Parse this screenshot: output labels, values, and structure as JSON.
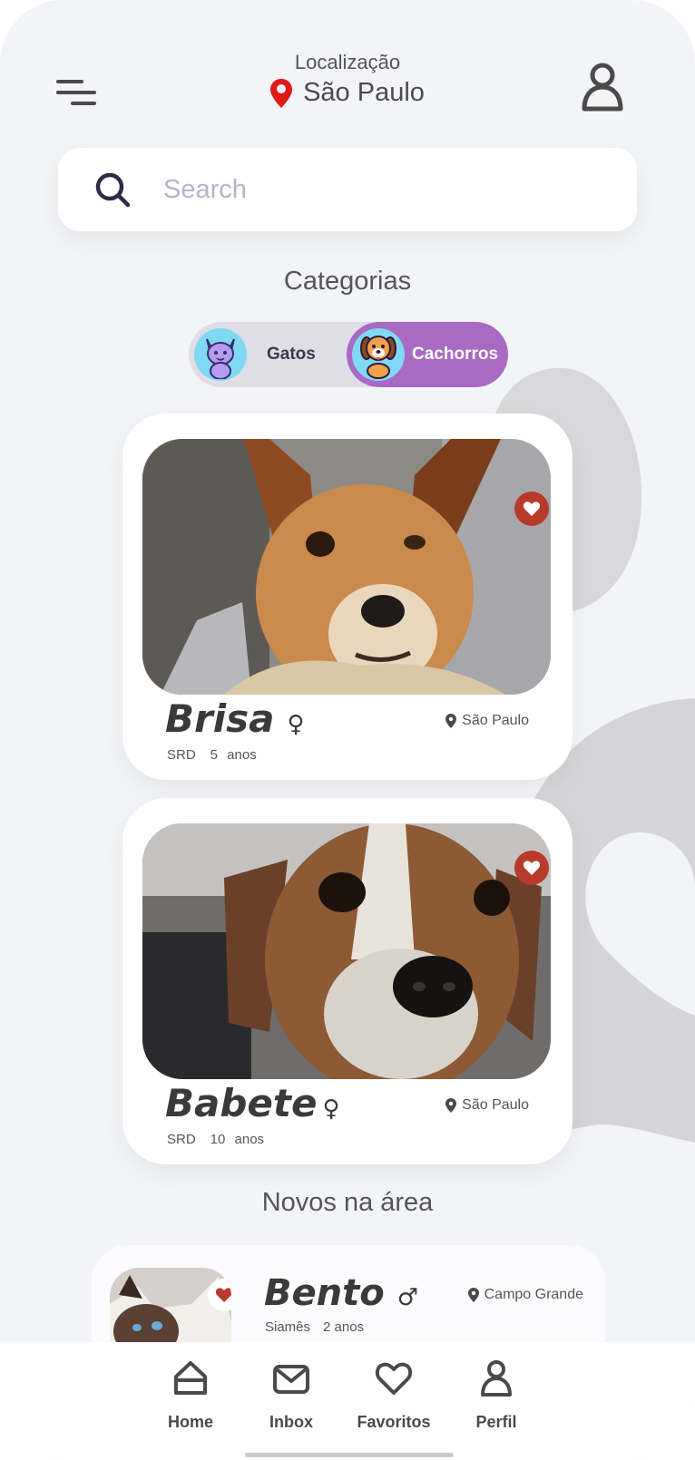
{
  "header": {
    "location_label": "Localização",
    "location_city": "São Paulo",
    "location_pin_color": "#e01818"
  },
  "search": {
    "placeholder": "Search"
  },
  "categories": {
    "title": "Categorias",
    "items": [
      {
        "label": "Gatos",
        "icon": "cat-icon",
        "selected": false
      },
      {
        "label": "Cachorros",
        "icon": "dog-icon",
        "selected": true
      }
    ],
    "accent": "#a86ac2"
  },
  "pets": [
    {
      "name": "Brisa",
      "gender": "♀",
      "breed": "SRD",
      "age": "5 anos",
      "location": "São Paulo",
      "favorite": true
    },
    {
      "name": "Babete",
      "gender": "♀",
      "breed": "SRD",
      "age": "10 anos",
      "location": "São Paulo",
      "favorite": true
    }
  ],
  "new_in_area": {
    "title": "Novos na área",
    "items": [
      {
        "name": "Bento",
        "gender": "♂",
        "breed": "Siamês",
        "age": "2 anos",
        "location": "Campo Grande",
        "favorite": true
      }
    ]
  },
  "nav": {
    "items": [
      {
        "label": "Home",
        "icon": "home-icon"
      },
      {
        "label": "Inbox",
        "icon": "mail-icon"
      },
      {
        "label": "Favoritos",
        "icon": "heart-icon"
      },
      {
        "label": "Perfil",
        "icon": "user-icon"
      }
    ]
  },
  "colors": {
    "heart": "#b73a2a",
    "background": "#f3f4f7"
  }
}
